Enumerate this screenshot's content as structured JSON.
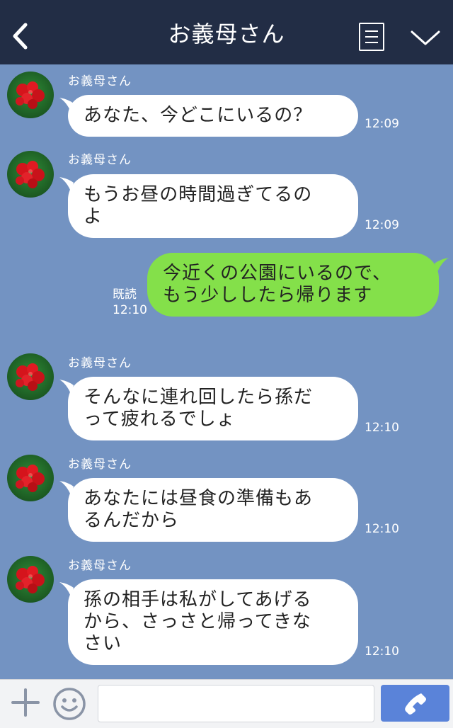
{
  "header": {
    "title": "お義母さん"
  },
  "messages": [
    {
      "sender": "お義母さん",
      "lines": [
        "あなた、今どこにいるの？"
      ],
      "time": "12:09"
    },
    {
      "sender": "お義母さん",
      "lines": [
        "もうお昼の時間過ぎてるの",
        "よ"
      ],
      "time": "12:09"
    },
    {
      "read_label": "既読",
      "lines": [
        "今近くの公園にいるので、",
        "もう少ししたら帰ります"
      ],
      "time": "12:10"
    },
    {
      "sender": "お義母さん",
      "lines": [
        "そんなに連れ回したら孫だ",
        "って疲れるでしょ"
      ],
      "time": "12:10"
    },
    {
      "sender": "お義母さん",
      "lines": [
        "あなたには昼食の準備もあ",
        "るんだから"
      ],
      "time": "12:10"
    },
    {
      "sender": "お義母さん",
      "lines": [
        "孫の相手は私がしてあげる",
        "から、さっさと帰ってきな",
        "さい"
      ],
      "time": "12:10"
    }
  ],
  "footer": {
    "input_value": ""
  },
  "icons": {
    "back": "chevron-left-icon",
    "menu": "menu-icon",
    "collapse": "chevron-down-icon",
    "avatar": "avatar-red-berries",
    "add": "plus-icon",
    "emoji": "smiley-icon",
    "call": "phone-icon"
  },
  "colors": {
    "header_bg": "#222d45",
    "chat_bg": "#7393c2",
    "incoming_bubble": "#ffffff",
    "outgoing_bubble": "#84e04a",
    "call_button": "#5a83d9"
  }
}
